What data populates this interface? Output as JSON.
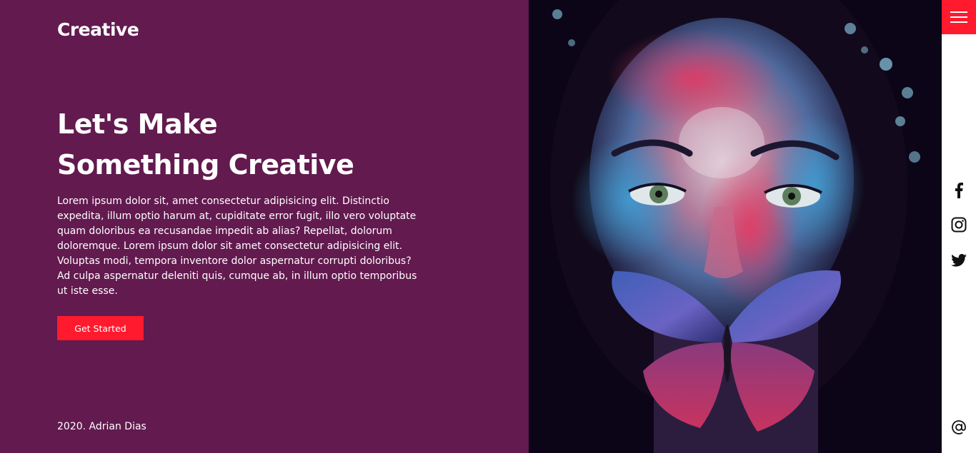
{
  "brand": {
    "logo": "Creative"
  },
  "hero": {
    "headline_line1": "Let's Make",
    "headline_line2": "Something Creative",
    "description": "Lorem ipsum dolor sit, amet consectetur adipisicing elit. Distinctio expedita, illum optio harum at, cupiditate error fugit, illo vero voluptate quam doloribus ea recusandae impedit ab alias? Repellat, dolorum doloremque. Lorem ipsum dolor sit amet consectetur adipisicing elit. Voluptas modi, tempora inventore dolor aspernatur corrupti doloribus? Ad culpa aspernatur deleniti quis, cumque ab, in illum optio temporibus ut iste esse.",
    "cta_label": "Get Started",
    "image_subject": "painted-face-with-butterfly"
  },
  "footer": {
    "text": "2020. Adrian Dias"
  },
  "sidebar": {
    "menu_icon": "hamburger-icon",
    "social": [
      "facebook-icon",
      "instagram-icon",
      "twitter-icon"
    ],
    "contact_icon": "at-sign-icon"
  },
  "colors": {
    "background": "#621a4f",
    "accent": "#ff1a2e",
    "sidebar": "#ffffff",
    "text": "#ffffff"
  }
}
